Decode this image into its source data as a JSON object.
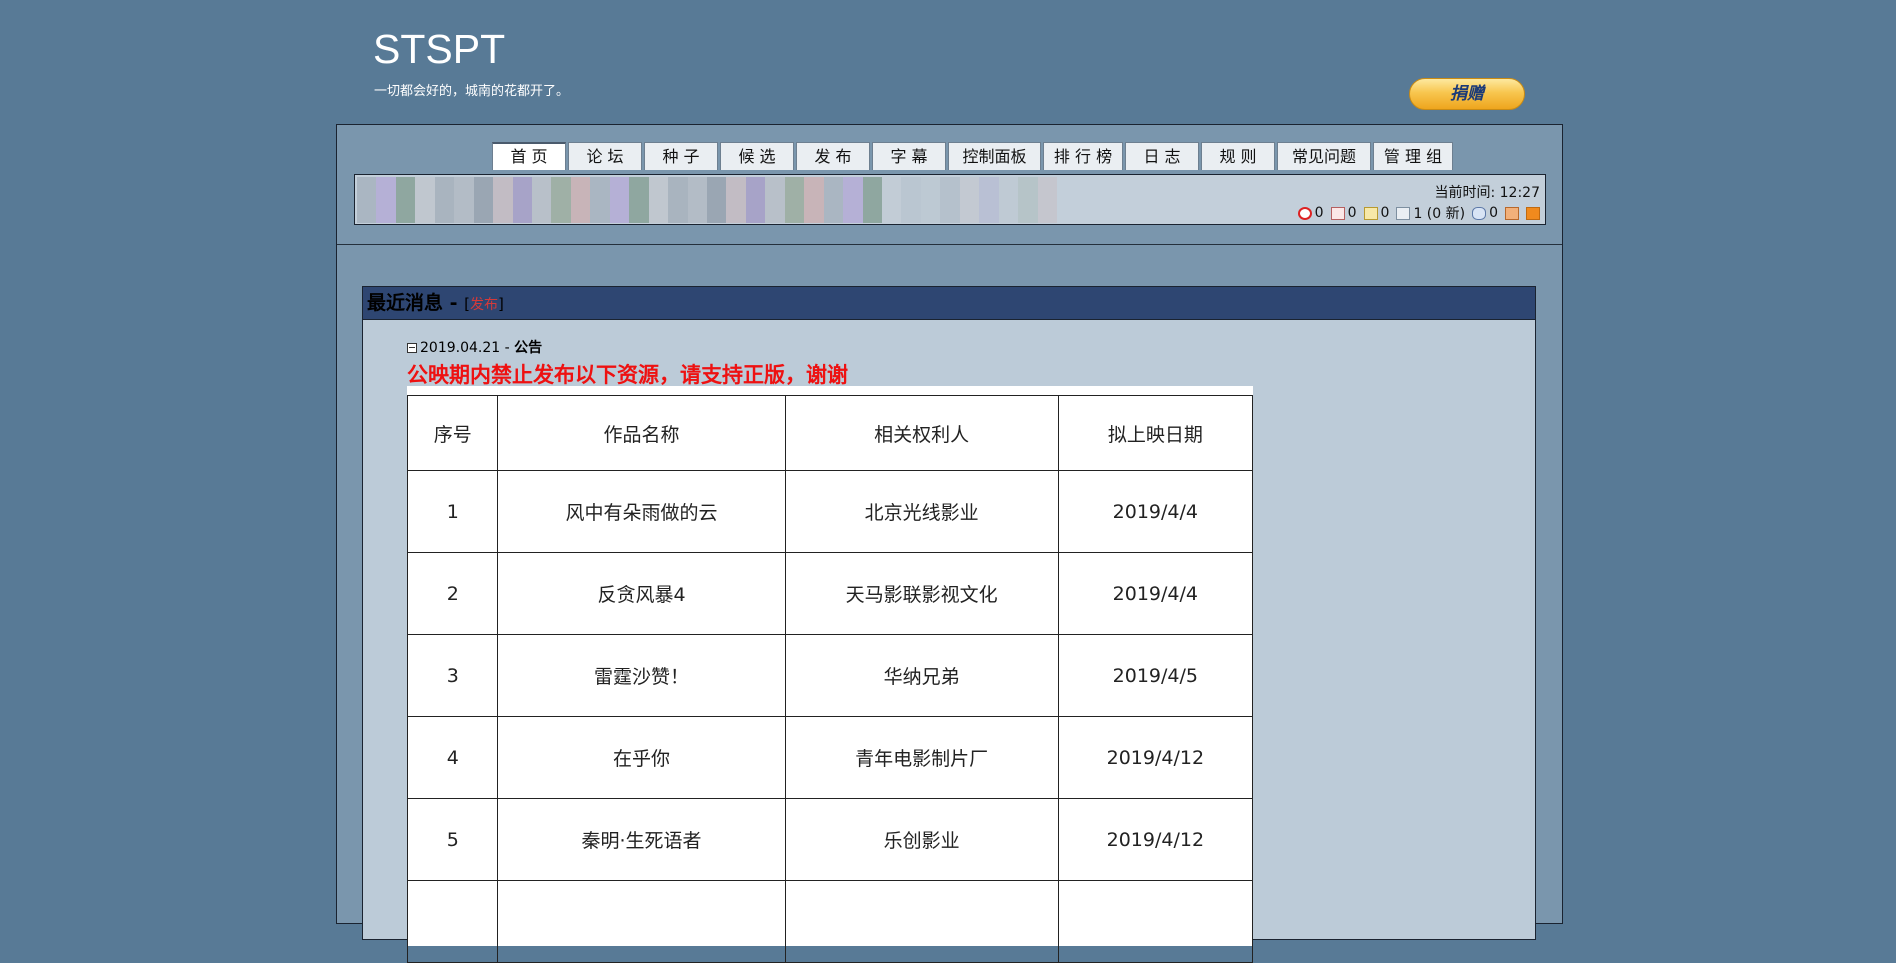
{
  "site": {
    "title": "STSPT",
    "slogan": "一切都会好的，城南的花都开了。",
    "donate_label": "捐赠"
  },
  "nav": {
    "tabs": [
      {
        "label": "首 页",
        "active": true
      },
      {
        "label": "论 坛"
      },
      {
        "label": "种 子"
      },
      {
        "label": "候 选"
      },
      {
        "label": "发 布"
      },
      {
        "label": "字 幕"
      },
      {
        "label": "控制面板"
      },
      {
        "label": "排 行 榜"
      },
      {
        "label": "日 志"
      },
      {
        "label": "规 则"
      },
      {
        "label": "常见问题"
      },
      {
        "label": "管 理 组"
      }
    ]
  },
  "userbar": {
    "time_label": "当前时间:",
    "time_value": "12:27",
    "stats": {
      "ban": "0",
      "mail_in": "0",
      "mail_new": "0",
      "messages": "1 (0 新)",
      "peers": "0"
    }
  },
  "news": {
    "header_label": "最近消息 - ",
    "bracket_open": "[",
    "post_label": "发布",
    "bracket_close": "]",
    "date": "2019.04.21",
    "separator": " - ",
    "category": "公告",
    "title": "公映期内禁止发布以下资源，请支持正版，谢谢",
    "table": {
      "headers": [
        "序号",
        "作品名称",
        "相关权利人",
        "拟上映日期"
      ],
      "rows": [
        [
          "1",
          "风中有朵雨做的云",
          "北京光线影业",
          "2019/4/4"
        ],
        [
          "2",
          "反贪风暴4",
          "天马影联影视文化",
          "2019/4/4"
        ],
        [
          "3",
          "雷霆沙赞！",
          "华纳兄弟",
          "2019/4/5"
        ],
        [
          "4",
          "在乎你",
          "青年电影制片厂",
          "2019/4/12"
        ],
        [
          "5",
          "秦明·生死语者",
          "乐创影业",
          "2019/4/12"
        ]
      ]
    }
  },
  "colors": {
    "background": "#587a96",
    "frame": "#7a96ad",
    "news_header": "#2e4672",
    "news_body": "#bccbd8",
    "title_red": "#ee1111"
  }
}
